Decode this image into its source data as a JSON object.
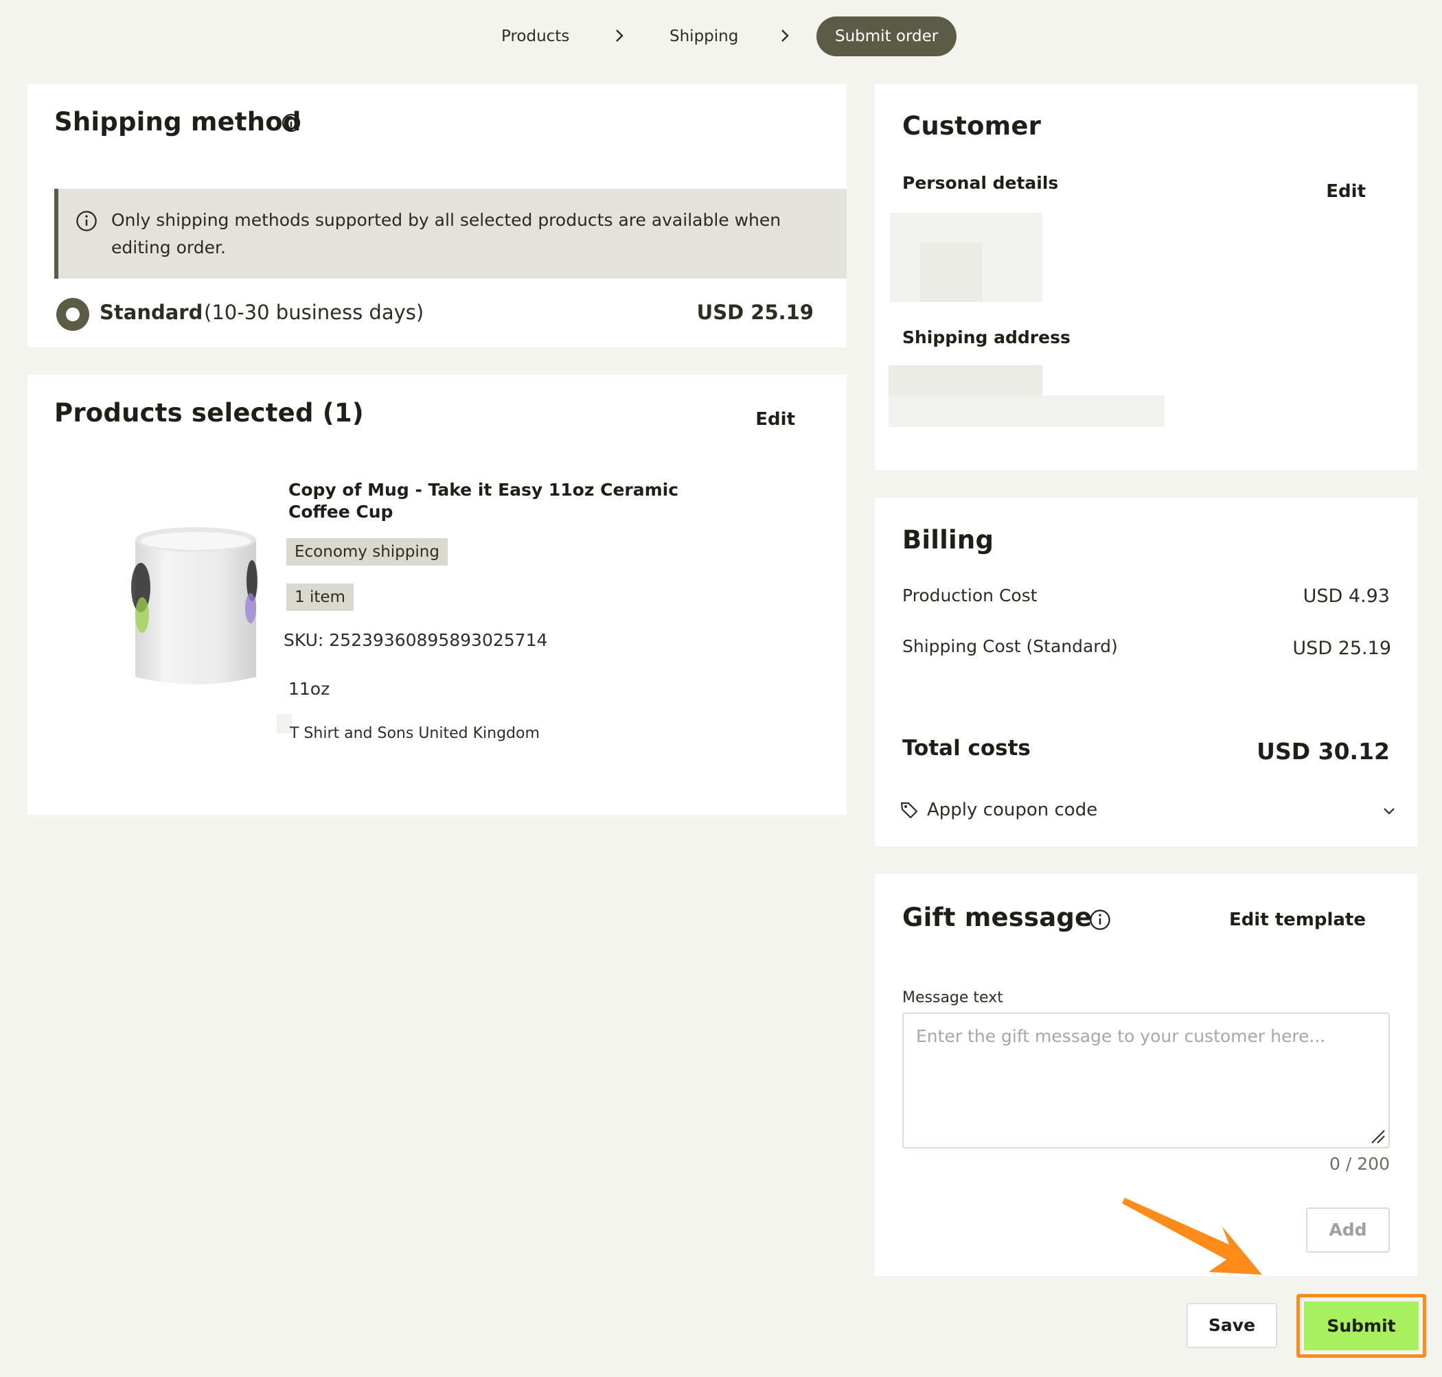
{
  "stepper": {
    "steps": [
      {
        "label": "Products"
      },
      {
        "label": "Shipping"
      },
      {
        "label": "Submit order"
      }
    ]
  },
  "shipping_method": {
    "title": "Shipping method",
    "notice": "Only shipping methods supported by all selected products are available when editing order.",
    "option": {
      "name": "Standard",
      "duration": "(10-30 business days)",
      "price": "USD 25.19",
      "selected": true
    }
  },
  "products": {
    "title": "Products selected (1)",
    "edit_label": "Edit",
    "item": {
      "name": "Copy of Mug - Take it Easy 11oz Ceramic Coffee Cup",
      "shipping_tag": "Economy shipping",
      "quantity_tag": "1 item",
      "sku": "SKU: 25239360895893025714",
      "variant": "11oz",
      "provider": "T Shirt and Sons United Kingdom"
    }
  },
  "customer": {
    "title": "Customer",
    "personal_details_label": "Personal details",
    "edit_label": "Edit",
    "shipping_address_label": "Shipping address"
  },
  "billing": {
    "title": "Billing",
    "rows": [
      {
        "label": "Production Cost",
        "value": "USD 4.93"
      },
      {
        "label": "Shipping Cost (Standard)",
        "value": "USD 25.19"
      }
    ],
    "total_label": "Total costs",
    "total_value": "USD 30.12",
    "coupon_label": "Apply coupon code"
  },
  "gift": {
    "title": "Gift message",
    "edit_template_label": "Edit template",
    "message_label": "Message text",
    "placeholder": "Enter the gift message to your customer here...",
    "counter": "0 / 200",
    "add_label": "Add"
  },
  "footer": {
    "save_label": "Save",
    "submit_label": "Submit"
  },
  "colors": {
    "accent": "#5c5b46",
    "submit_bg": "#a8f060",
    "highlight": "#ff8c1a",
    "page_bg": "#f4f4ef"
  }
}
